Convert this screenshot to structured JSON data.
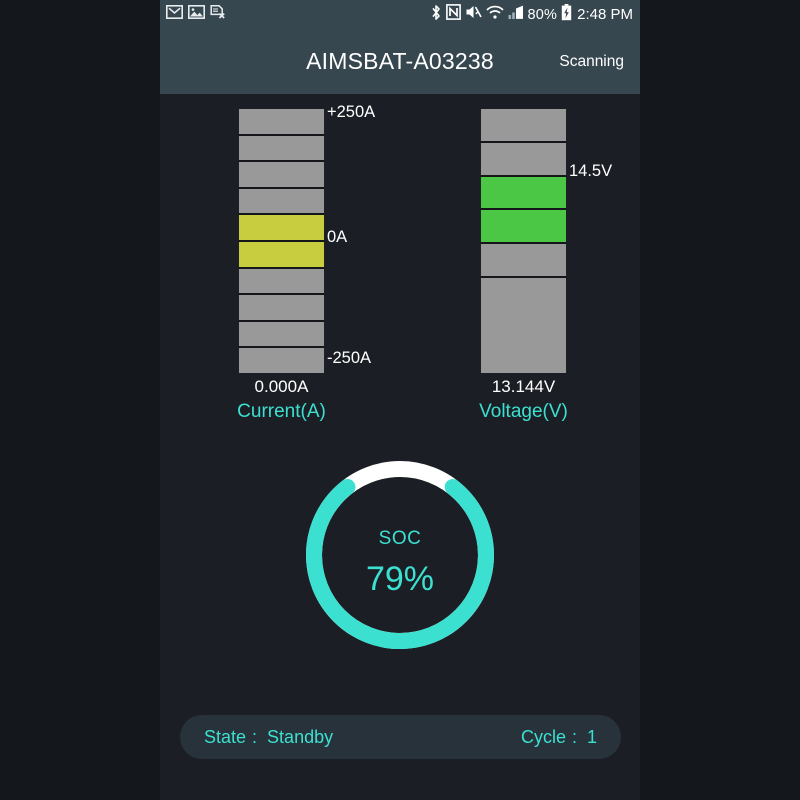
{
  "status_bar": {
    "left_icons": [
      {
        "name": "gmail-icon",
        "glyph": "M"
      },
      {
        "name": "gallery-image-icon",
        "glyph": "IMG"
      },
      {
        "name": "document-error-icon",
        "glyph": "DOCX"
      }
    ],
    "right_icons": [
      {
        "name": "bluetooth-icon"
      },
      {
        "name": "nfc-icon"
      },
      {
        "name": "sound-mute-icon"
      },
      {
        "name": "wifi-icon"
      },
      {
        "name": "cellular-signal-icon"
      }
    ],
    "battery_percent": "80%",
    "battery_state": "charging",
    "clock": "2:48 PM"
  },
  "title_bar": {
    "device_name": "AIMSBAT-A03238",
    "scan_status": "Scanning"
  },
  "gauges": [
    {
      "id": "current",
      "axis_title": "Current(A)",
      "readout": "0.000A",
      "top_label": "+250A",
      "mid_label": "0A",
      "bottom_label": "-250A",
      "active_color": "#c8cc3f",
      "inactive_color": "#999999",
      "segment_count": 10,
      "active_segments": [
        4,
        5
      ]
    },
    {
      "id": "voltage",
      "axis_title": "Voltage(V)",
      "readout": "13.144V",
      "marker_label": "14.5V",
      "active_color": "#4cc645",
      "inactive_color": "#999999",
      "segment_count": 6,
      "segment_flex": [
        1,
        1,
        1,
        1,
        1,
        3
      ],
      "active_segments": [
        2,
        3
      ]
    }
  ],
  "soc": {
    "label": "SOC",
    "value_text": "79%",
    "percent": 79,
    "arc_color": "#3ce0d0",
    "track_color": "#ffffff"
  },
  "state_bar": {
    "state_key": "State",
    "state_sep": ":",
    "state_value": "Standby",
    "cycle_key": "Cycle",
    "cycle_sep": ":",
    "cycle_value": "1"
  },
  "colors": {
    "background": "#1b1f25",
    "outer_background": "#14171c",
    "header": "#36474f",
    "accent": "#3ce0d0",
    "state_bar_bg": "#28323a"
  }
}
